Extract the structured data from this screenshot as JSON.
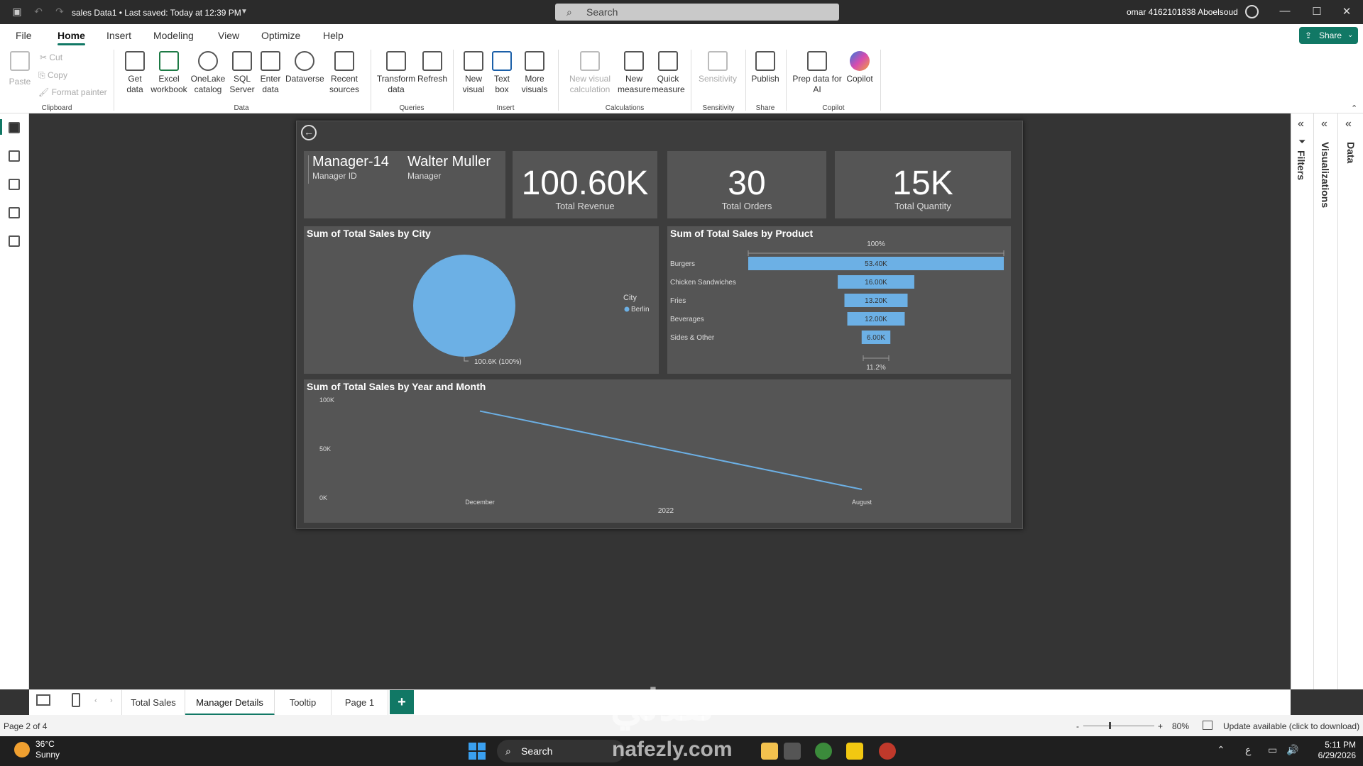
{
  "titlebar": {
    "document": "sales Data1  •  Last saved: Today at 12:39 PM",
    "search_placeholder": "Search",
    "user": "omar 4162101838 Aboelsoud"
  },
  "menu": {
    "tabs": [
      "File",
      "Home",
      "Insert",
      "Modeling",
      "View",
      "Optimize",
      "Help"
    ],
    "active": "Home",
    "share_label": "Share"
  },
  "ribbon": {
    "clipboard": {
      "paste": "Paste",
      "cut": "Cut",
      "copy": "Copy",
      "format_painter": "Format painter",
      "label": "Clipboard"
    },
    "data": {
      "get_data": "Get\ndata",
      "excel": "Excel\nworkbook",
      "onelake": "OneLake\ncatalog",
      "sql": "SQL\nServer",
      "enter": "Enter\ndata",
      "dataverse": "Dataverse",
      "recent": "Recent\nsources",
      "label": "Data"
    },
    "queries": {
      "transform": "Transform\ndata",
      "refresh": "Refresh",
      "label": "Queries"
    },
    "insert": {
      "new_visual": "New\nvisual",
      "text_box": "Text\nbox",
      "more_visuals": "More\nvisuals",
      "label": "Insert"
    },
    "calculations": {
      "new_visual_calc": "New visual\ncalculation",
      "new_measure": "New\nmeasure",
      "quick_measure": "Quick\nmeasure",
      "label": "Calculations"
    },
    "sensitivity": {
      "sensitivity": "Sensitivity",
      "label": "Sensitivity"
    },
    "share": {
      "publish": "Publish",
      "label": "Share"
    },
    "copilot": {
      "prep": "Prep data for\nAI",
      "copilot": "Copilot",
      "label": "Copilot"
    }
  },
  "panes": {
    "filters": "Filters",
    "visualizations": "Visualizations",
    "data": "Data"
  },
  "report": {
    "manager": {
      "id_value": "Manager-14",
      "id_label": "Manager ID",
      "name_value": "Walter Muller",
      "name_label": "Manager"
    },
    "kpis": [
      {
        "value": "100.60K",
        "label": "Total Revenue"
      },
      {
        "value": "30",
        "label": "Total Orders"
      },
      {
        "value": "15K",
        "label": "Total Quantity"
      }
    ],
    "city_chart": {
      "title": "Sum of Total Sales by City",
      "legend_title": "City",
      "legend_item": "Berlin",
      "data_label": "100.6K (100%)",
      "slice_color": "#6CB0E5"
    },
    "product_chart": {
      "title": "Sum of Total Sales by Product",
      "top_label": "100%",
      "bottom_label": "11.2%",
      "bar_color": "#6CB0E5"
    },
    "trend_chart": {
      "title": "Sum of Total Sales by Year and Month",
      "year_label": "2022",
      "line_color": "#6CB0E5"
    }
  },
  "chart_data": [
    {
      "type": "pie",
      "title": "Sum of Total Sales by City",
      "legend_title": "City",
      "categories": [
        "Berlin"
      ],
      "values": [
        100.6
      ],
      "unit": "K"
    },
    {
      "type": "bar",
      "title": "Sum of Total Sales by Product",
      "categories": [
        "Burgers",
        "Chicken Sandwiches",
        "Fries",
        "Beverages",
        "Sides & Other"
      ],
      "values": [
        53.4,
        16.0,
        13.2,
        12.0,
        6.0
      ],
      "value_labels": [
        "53.40K",
        "16.00K",
        "13.20K",
        "12.00K",
        "6.00K"
      ],
      "unit": "K",
      "max": 53.4
    },
    {
      "type": "line",
      "title": "Sum of Total Sales by Year and Month",
      "x": [
        "December",
        "August"
      ],
      "x_group": "2022",
      "series": [
        {
          "values": [
            88,
            8
          ]
        }
      ],
      "y_ticks": [
        "100K",
        "50K",
        "0K"
      ],
      "ylim": [
        0,
        100
      ]
    }
  ],
  "pages": {
    "tabs": [
      "Total Sales",
      "Manager Details",
      "Tooltip",
      "Page 1"
    ],
    "active": "Manager Details"
  },
  "status": {
    "page_info": "Page 2 of 4",
    "zoom": "80%",
    "update": "Update available (click to download)"
  },
  "taskbar": {
    "temperature": "36°C",
    "condition": "Sunny",
    "search": "Search",
    "time": "5:11 PM",
    "date": "6/29/2026"
  },
  "watermark": {
    "arabic": "نفذلي",
    "latin": "nafezly.com"
  }
}
